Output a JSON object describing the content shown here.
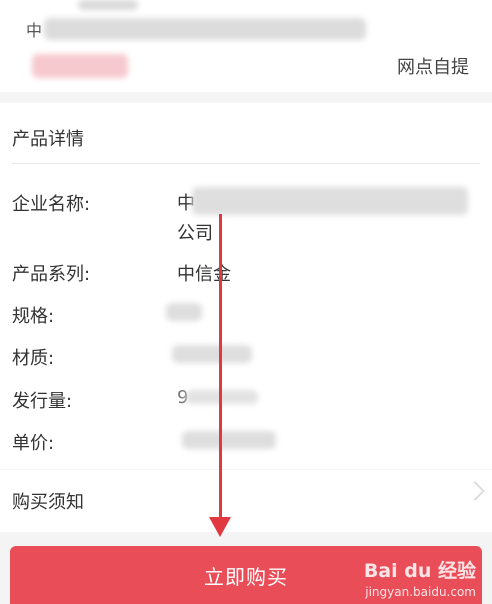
{
  "top": {
    "partial_char": "中",
    "pickup_method": "网点自提"
  },
  "details": {
    "title": "产品详情",
    "rows": [
      {
        "label": "企业名称:",
        "value_prefix": "中",
        "value_line2": "公司"
      },
      {
        "label": "产品系列:",
        "value": "中信金"
      },
      {
        "label": "规格:"
      },
      {
        "label": "材质:"
      },
      {
        "label": "发行量:",
        "value_partial": "9"
      },
      {
        "label": "单价:"
      }
    ]
  },
  "notice": {
    "title": "购买须知"
  },
  "buy_button": {
    "label": "立即购买"
  },
  "watermark": {
    "brand": "Bai du 经验",
    "url": "jingyan.baidu.com"
  },
  "colors": {
    "accent": "#e84d58",
    "arrow": "#e0393f"
  }
}
